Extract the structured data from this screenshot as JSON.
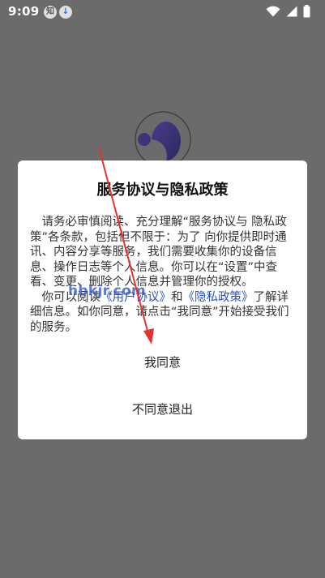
{
  "status_bar": {
    "time": "9:09",
    "notifications": [
      {
        "icon": "zhihu-icon",
        "glyph": "知"
      },
      {
        "icon": "download-icon",
        "glyph": "↓"
      }
    ],
    "icons": [
      "wifi-icon",
      "cellular-signal-icon",
      "battery-icon"
    ]
  },
  "dialog": {
    "title": "服务协议与隐私政策",
    "para1": "请务必审慎阅读、充分理解“服务协议与 隐私政策”各条款，包括但不限于：为了 向你提供即时通讯、内容分享等服务，我们需要收集你的设备信息、操作日志等个人信息。你可以在“设置”中查看、变更、删除个人信息并管理你的授权。",
    "para2_before": "你可以阅读",
    "link_user_agreement": "《用户协议》",
    "para2_and": "和",
    "link_privacy_policy": "《隐私政策》",
    "para2_after": "了解详细信息。如你同意，请点击“我同意”开始接受我们的服务。",
    "agree_label": "我同意",
    "disagree_label": "不同意退出"
  },
  "watermark": "hbkjr.com",
  "colors": {
    "overlay_background": "#6b6b6b",
    "dialog_background": "#ffffff",
    "link": "#2a4fc4",
    "annotation_arrow": "#e8302e"
  }
}
